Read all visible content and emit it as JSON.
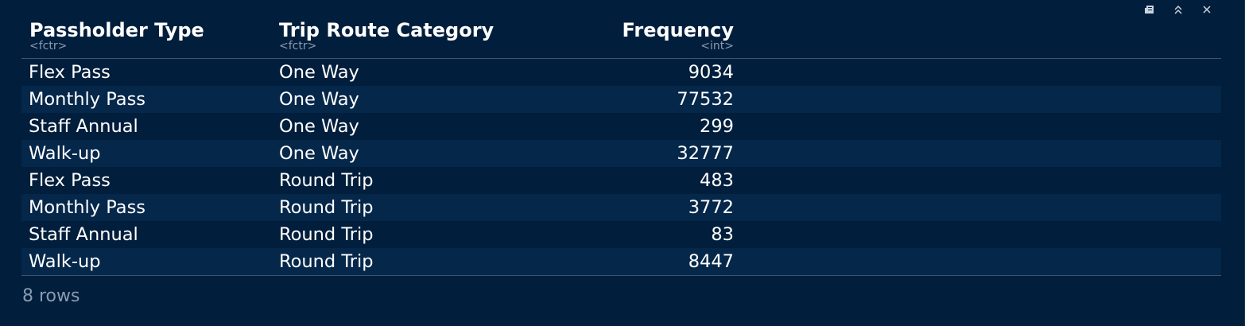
{
  "toolbar": {
    "icons": [
      "export-icon",
      "collapse-icon",
      "close-icon"
    ]
  },
  "table": {
    "columns": [
      {
        "name": "Passholder Type",
        "type": "<fctr>"
      },
      {
        "name": "Trip Route Category",
        "type": "<fctr>"
      },
      {
        "name": "Frequency",
        "type": "<int>"
      }
    ],
    "rows": [
      [
        "Flex Pass",
        "One Way",
        "9034"
      ],
      [
        "Monthly Pass",
        "One Way",
        "77532"
      ],
      [
        "Staff Annual",
        "One Way",
        "299"
      ],
      [
        "Walk-up",
        "One Way",
        "32777"
      ],
      [
        "Flex Pass",
        "Round Trip",
        "483"
      ],
      [
        "Monthly Pass",
        "Round Trip",
        "3772"
      ],
      [
        "Staff Annual",
        "Round Trip",
        "83"
      ],
      [
        "Walk-up",
        "Round Trip",
        "8447"
      ]
    ]
  },
  "footer": {
    "row_count": "8 rows"
  },
  "colors": {
    "background": "#011e3c",
    "row_alt": "#05274a",
    "text": "#ffffff",
    "muted": "#8a9bb0"
  }
}
